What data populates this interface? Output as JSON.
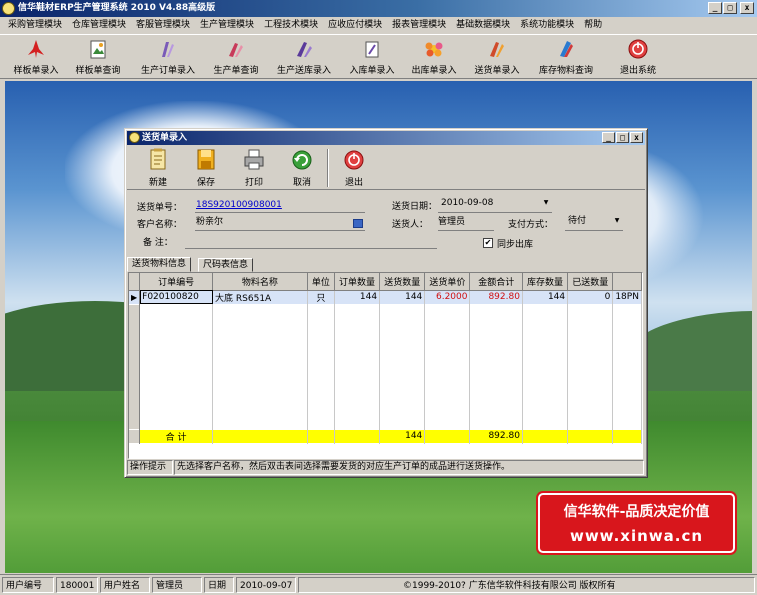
{
  "app": {
    "title": "信华鞋材ERP生产管理系统    2010   V4.88高级版",
    "win_min": "_",
    "win_max": "□",
    "win_close": "x"
  },
  "menu": [
    "采购管理模块",
    "仓库管理模块",
    "客服管理模块",
    "生产管理模块",
    "工程技术模块",
    "应收应付模块",
    "报表管理模块",
    "基础数据模块",
    "系统功能模块",
    "帮助"
  ],
  "toolbar": [
    {
      "label": "样板单录入",
      "icon": "pdf-doc-icon"
    },
    {
      "label": "样板单查询",
      "icon": "image-doc-icon"
    },
    {
      "label": "生产订单录入",
      "icon": "order-entry-icon"
    },
    {
      "label": "生产单查询",
      "icon": "production-query-icon"
    },
    {
      "label": "生产送库录入",
      "icon": "delivery-to-stock-icon"
    },
    {
      "label": "入库单录入",
      "icon": "inbound-icon"
    },
    {
      "label": "出库单录入",
      "icon": "outbound-icon"
    },
    {
      "label": "送货单录入",
      "icon": "shipment-icon"
    },
    {
      "label": "库存物料查询",
      "icon": "inventory-icon"
    },
    {
      "label": "退出系统",
      "icon": "power-icon"
    }
  ],
  "child_window": {
    "title": "送货单录入",
    "tools": [
      {
        "label": "新建",
        "icon": "new-doc-icon"
      },
      {
        "label": "保存",
        "icon": "save-icon"
      },
      {
        "label": "打印",
        "icon": "printer-icon"
      },
      {
        "label": "取消",
        "icon": "undo-icon"
      },
      {
        "label": "退出",
        "icon": "exit-icon"
      }
    ],
    "form": {
      "no_label": "送货单号：",
      "no_value": "18S920100908001",
      "date_label": "送货日期：",
      "date_value": "2010-09-08",
      "customer_label": "客户名称：",
      "customer_value": "粉亲尔",
      "sender_label": "送货人：",
      "sender_value": "管理员",
      "payment_label": "支付方式：",
      "payment_value": "待付",
      "remark_label": "备  注：",
      "remark_value": "",
      "sync_label": "同步出库",
      "sync_checked": "✔"
    },
    "tabs": [
      "送货物料信息",
      "尺码表信息"
    ],
    "grid": {
      "columns": [
        "订单编号",
        "物料名称",
        "单位",
        "订单数量",
        "送货数量",
        "送货单价",
        "金额合计",
        "库存数量",
        "已送数量",
        ""
      ],
      "rows": [
        {
          "marker": "▶",
          "order_no": "F020100820",
          "material": "大底   RS651A",
          "unit": "只",
          "order_qty": "144",
          "ship_qty": "144",
          "price": "6.2000",
          "amount": "892.80",
          "stock": "144",
          "shipped": "0",
          "extra": "18PN"
        }
      ],
      "total": {
        "label": "合  计",
        "ship_qty": "144",
        "amount": "892.80"
      }
    },
    "hint_label": "操作提示",
    "hint_text": "先选择客户名称，然后双击表间选择需要发货的对应生产订单的成品进行送货操作。"
  },
  "promo": {
    "line1": "信华软件-品质决定价值",
    "line2": "www.xinwa.cn"
  },
  "status": {
    "user_no_label": "用户编号",
    "user_no": "180001",
    "user_name_label": "用户姓名",
    "user_name": "管理员",
    "date_label": "日期",
    "date": "2010-09-07",
    "copyright": "©1999-2010?   广东信华软件科技有限公司    版权所有"
  }
}
